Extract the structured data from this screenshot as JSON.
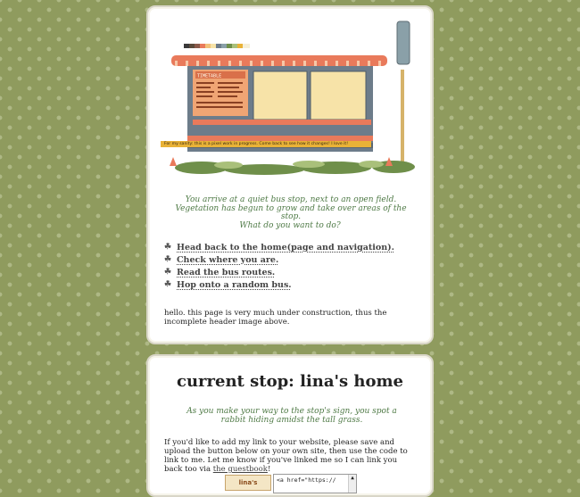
{
  "header": {
    "marquee_text": "For my sanity: this is a pixel work in progress. Come back to see how it changes! I love it!",
    "timetable_title": "TIMETABLE"
  },
  "intro": {
    "text": "You arrive at a quiet bus stop, next to an open field. Vegetation has begun to grow and take over areas of the stop.",
    "question": "What do you want to do?"
  },
  "links": [
    {
      "label": "Head back to the home(page and navigation)."
    },
    {
      "label": "Check where you are."
    },
    {
      "label": "Read the bus routes."
    },
    {
      "label": "Hop onto a random bus."
    }
  ],
  "note": "hello. this page is very much under construction, thus the incomplete header image above.",
  "current_stop": {
    "title": "current stop: lina's home",
    "intro": "As you make your way to the stop's sign, you spot a rabbit hiding amidst the tall grass.",
    "body_text": "If you'd like to add my link to your website, please save and upload the button below on your own site, then use the code to link to me. Let me know if you've linked me so I can link you back too via",
    "guestbook_link": "the guestbook",
    "body_end": "!",
    "button_label": "lina's",
    "code_snippet": "<a href=\"https://"
  },
  "colors": {
    "background": "#8f9b5e",
    "accent_green": "#4f7a46",
    "roof": "#e97a5b",
    "shelter": "#6d7c8a"
  }
}
